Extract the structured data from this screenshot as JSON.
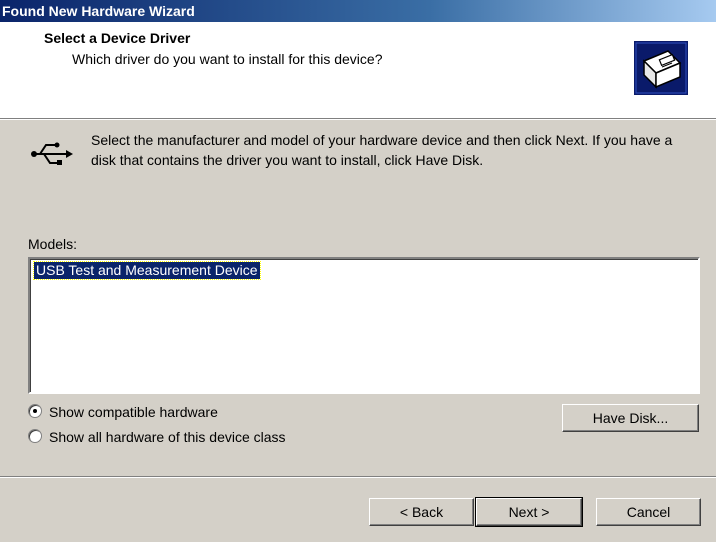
{
  "window": {
    "title": "Found New Hardware Wizard"
  },
  "header": {
    "title": "Select a Device Driver",
    "subtitle": "Which driver do you want to install for this device?",
    "icon": "hardware-box-icon"
  },
  "instructions": {
    "icon": "usb-icon",
    "text": "Select the manufacturer and model of your hardware device and then click Next. If you have a disk that contains the driver you want to install, click Have Disk."
  },
  "models": {
    "label": "Models:",
    "items": [
      "USB Test and Measurement Device"
    ],
    "selected_index": 0
  },
  "options": {
    "show_compatible_label": "Show compatible hardware",
    "show_all_label": "Show all hardware of this device class",
    "selected": "show_compatible"
  },
  "buttons": {
    "have_disk": "Have Disk...",
    "back": "< Back",
    "next": "Next >",
    "cancel": "Cancel"
  },
  "colors": {
    "selection": "#0a246a",
    "dialog_face": "#d4d0c8"
  }
}
